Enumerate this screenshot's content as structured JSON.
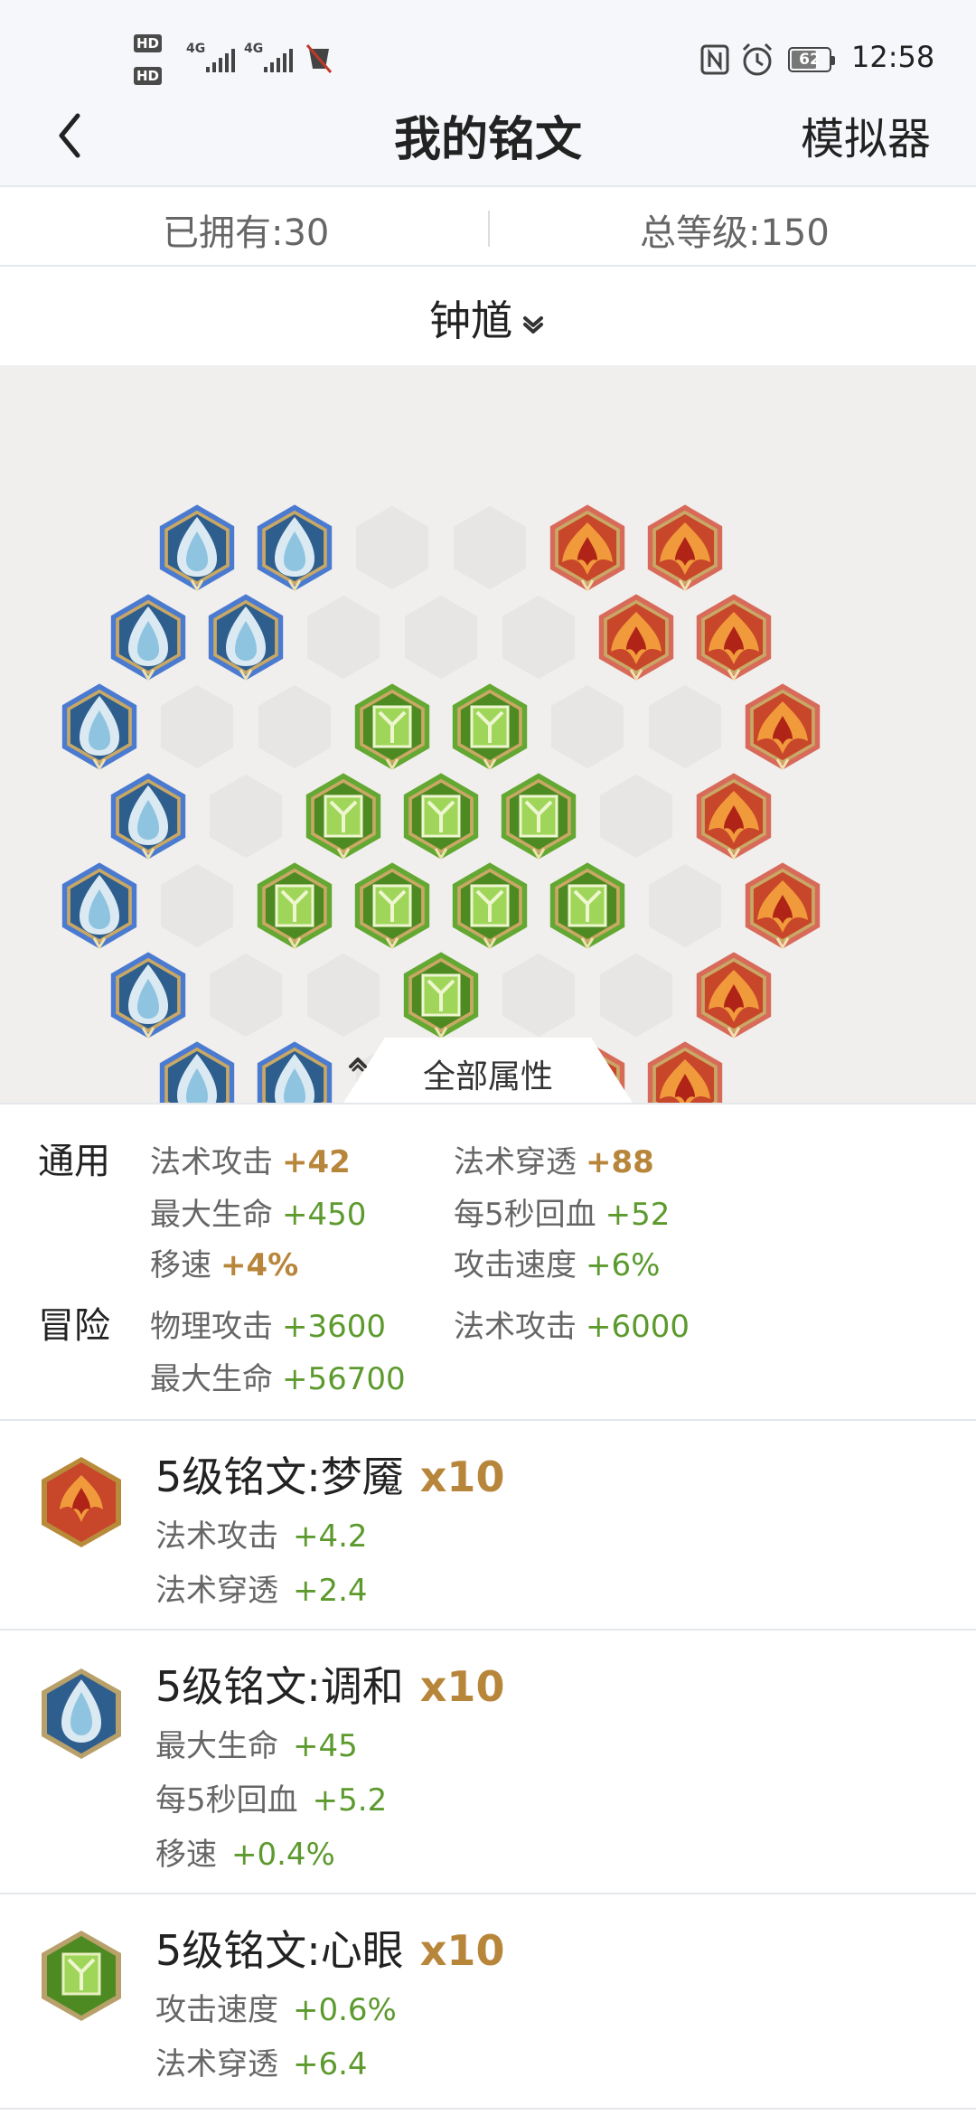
{
  "status_bar": {
    "hd1": "HD",
    "hd2": "HD",
    "net1": "4G",
    "net2": "4G",
    "battery": "62",
    "time": "12:58"
  },
  "header": {
    "title": "我的铭文",
    "simulator_label": "模拟器"
  },
  "summary": {
    "owned": "已拥有:30",
    "total_level": "总等级:150"
  },
  "hero": {
    "name": "钟馗"
  },
  "board": {
    "colors": {
      "blue": "#4a7bd0",
      "red": "#d86a5a",
      "green": "#62a832",
      "empty": "#e8e6e4"
    },
    "tab_label": "全部属性"
  },
  "attributes": {
    "general_label": "通用",
    "adventure_label": "冒险",
    "general": [
      {
        "name": "法术攻击",
        "value": "+42",
        "style": "gold"
      },
      {
        "name": "法术穿透",
        "value": "+88",
        "style": "gold"
      },
      {
        "name": "最大生命",
        "value": "+450",
        "style": "green"
      },
      {
        "name": "每5秒回血",
        "value": "+52",
        "style": "green"
      },
      {
        "name": "移速",
        "value": "+4%",
        "style": "gold"
      },
      {
        "name": "攻击速度",
        "value": "+6%",
        "style": "green"
      }
    ],
    "adventure": [
      {
        "name": "物理攻击",
        "value": "+3600"
      },
      {
        "name": "法术攻击",
        "value": "+6000"
      },
      {
        "name": "最大生命",
        "value": "+56700"
      }
    ]
  },
  "inscriptions": [
    {
      "icon": "red-inscription-icon",
      "title": "5级铭文:梦魇",
      "count": "x10",
      "stats": [
        {
          "name": "法术攻击",
          "value": "+4.2"
        },
        {
          "name": "法术穿透",
          "value": "+2.4"
        }
      ]
    },
    {
      "icon": "blue-inscription-icon",
      "title": "5级铭文:调和",
      "count": "x10",
      "stats": [
        {
          "name": "最大生命",
          "value": "+45"
        },
        {
          "name": "每5秒回血",
          "value": "+5.2"
        },
        {
          "name": "移速",
          "value": "+0.4%"
        }
      ]
    },
    {
      "icon": "green-inscription-icon",
      "title": "5级铭文:心眼",
      "count": "x10",
      "stats": [
        {
          "name": "攻击速度",
          "value": "+0.6%"
        },
        {
          "name": "法术穿透",
          "value": "+6.4"
        }
      ]
    }
  ]
}
